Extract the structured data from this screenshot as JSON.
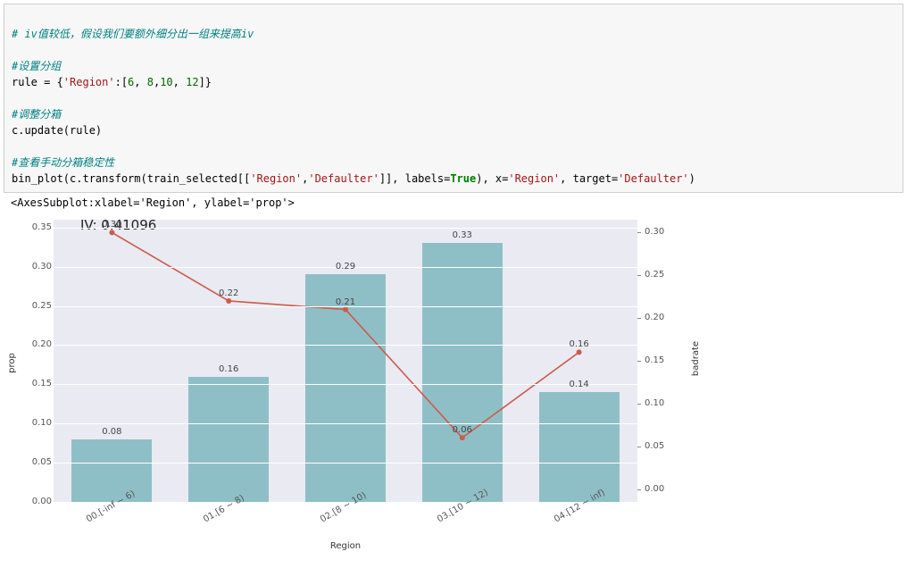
{
  "code": {
    "comment1": "# iv值较低，假设我们要额外细分出一组来提高iv",
    "comment2": "#设置分组",
    "line_rule_a": "rule = {",
    "line_rule_key": "'Region'",
    "line_rule_b": ":[",
    "line_rule_n1": "6",
    "line_rule_c1": ", ",
    "line_rule_n2": "8",
    "line_rule_c2": ",",
    "line_rule_n3": "10",
    "line_rule_c3": ", ",
    "line_rule_n4": "12",
    "line_rule_d": "]}",
    "comment3": "#调整分箱",
    "line_update": "c.update(rule)",
    "comment4": "#查看手动分箱稳定性",
    "line_call_a": "bin_plot(c.transform(train_selected[[",
    "line_call_s1": "'Region'",
    "line_call_b": ",",
    "line_call_s2": "'Defaulter'",
    "line_call_c": "]], labels=",
    "line_call_true": "True",
    "line_call_d": "), x=",
    "line_call_s3": "'Region'",
    "line_call_e": ", target=",
    "line_call_s4": "'Defaulter'",
    "line_call_f": ")"
  },
  "output_repr": "<AxesSubplot:xlabel='Region', ylabel='prop'>",
  "chart_data": {
    "type": "bar",
    "title": "IV: 0.41096",
    "xlabel": "Region",
    "ylabel": "prop",
    "ylabel2": "badrate",
    "categories": [
      "00.[-inf ~ 6)",
      "01.[6 ~ 8)",
      "02.[8 ~ 10)",
      "03.[10 ~ 12)",
      "04.[12 ~ inf)"
    ],
    "values": [
      0.08,
      0.16,
      0.29,
      0.33,
      0.14
    ],
    "y_ticks": [
      0.0,
      0.05,
      0.1,
      0.15,
      0.2,
      0.25,
      0.3,
      0.35
    ],
    "ylim": [
      0.0,
      0.36
    ],
    "line_series": {
      "name": "badrate",
      "values": [
        0.3,
        0.22,
        0.21,
        0.06,
        0.16
      ]
    },
    "y2_ticks": [
      0.0,
      0.05,
      0.1,
      0.15,
      0.2,
      0.25,
      0.3
    ],
    "y2lim": [
      -0.015,
      0.315
    ]
  }
}
